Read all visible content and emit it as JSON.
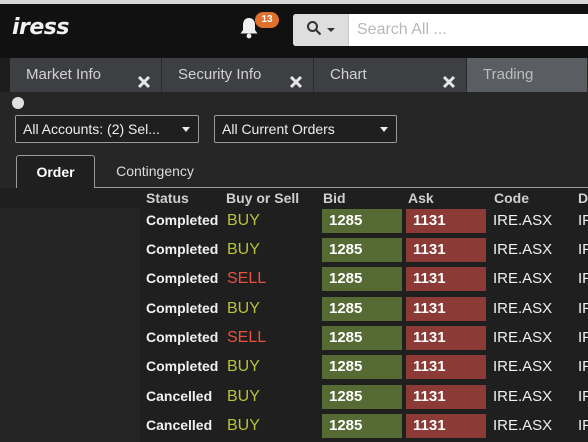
{
  "app": {
    "logo": "iress"
  },
  "notifications": {
    "count": "13"
  },
  "search": {
    "placeholder": "Search All ..."
  },
  "tabs": [
    {
      "label": "Market Info"
    },
    {
      "label": "Security Info"
    },
    {
      "label": "Chart"
    },
    {
      "label": "Trading"
    }
  ],
  "filters": {
    "accounts": "All Accounts: (2) Sel...",
    "orders": "All Current Orders"
  },
  "subtabs": [
    {
      "label": "Order"
    },
    {
      "label": "Contingency"
    }
  ],
  "table": {
    "headers": [
      "Status",
      "Buy or Sell",
      "Bid",
      "Ask",
      "Code",
      "D"
    ],
    "rows": [
      {
        "status": "Completed",
        "side": "BUY",
        "bid": "1285",
        "ask": "1131",
        "code": "IRE.ASX",
        "extra": "IF"
      },
      {
        "status": "Completed",
        "side": "BUY",
        "bid": "1285",
        "ask": "1131",
        "code": "IRE.ASX",
        "extra": "IF"
      },
      {
        "status": "Completed",
        "side": "SELL",
        "bid": "1285",
        "ask": "1131",
        "code": "IRE.ASX",
        "extra": "IF"
      },
      {
        "status": "Completed",
        "side": "BUY",
        "bid": "1285",
        "ask": "1131",
        "code": "IRE.ASX",
        "extra": "IF"
      },
      {
        "status": "Completed",
        "side": "SELL",
        "bid": "1285",
        "ask": "1131",
        "code": "IRE.ASX",
        "extra": "IF"
      },
      {
        "status": "Completed",
        "side": "BUY",
        "bid": "1285",
        "ask": "1131",
        "code": "IRE.ASX",
        "extra": "IF"
      },
      {
        "status": "Cancelled",
        "side": "BUY",
        "bid": "1285",
        "ask": "1131",
        "code": "IRE.ASX",
        "extra": "IF"
      },
      {
        "status": "Cancelled",
        "side": "BUY",
        "bid": "1285",
        "ask": "1131",
        "code": "IRE.ASX",
        "extra": "IF"
      }
    ]
  },
  "colors": {
    "buy": "#b5c33a",
    "sell": "#e8513f",
    "bid_bg": "#566b34",
    "ask_bg": "#8b3a36",
    "badge": "#e0702a"
  },
  "icons": [
    "bell-icon",
    "search-icon",
    "chevron-down-icon",
    "close-icon"
  ]
}
